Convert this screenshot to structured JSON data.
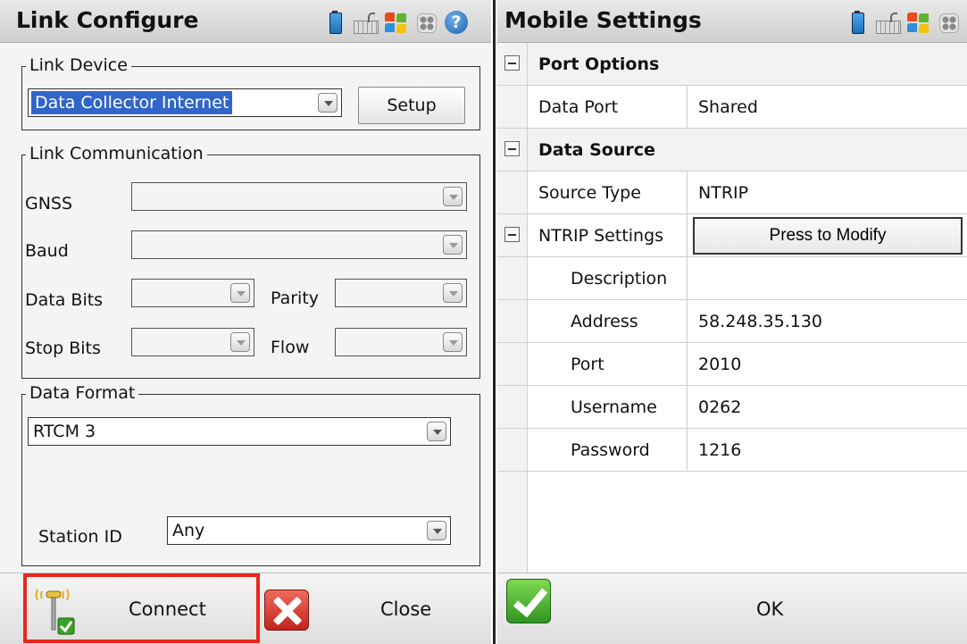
{
  "left": {
    "title": "Link Configure",
    "link_device": {
      "legend": "Link Device",
      "selected": "Data Collector Internet",
      "setup_label": "Setup"
    },
    "link_communication": {
      "legend": "Link Communication",
      "gnss_label": "GNSS",
      "baud_label": "Baud",
      "data_bits_label": "Data Bits",
      "parity_label": "Parity",
      "stop_bits_label": "Stop Bits",
      "flow_label": "Flow"
    },
    "data_format": {
      "legend": "Data Format",
      "selected": "RTCM 3",
      "station_id_label": "Station ID",
      "station_id_value": "Any"
    },
    "bottom": {
      "connect_label": "Connect",
      "close_label": "Close"
    }
  },
  "right": {
    "title": "Mobile Settings",
    "grid": {
      "port_options": "Port Options",
      "data_port_label": "Data Port",
      "data_port_value": "Shared",
      "data_source": "Data Source",
      "source_type_label": "Source Type",
      "source_type_value": "NTRIP",
      "ntrip_settings_label": "NTRIP Settings",
      "ntrip_settings_button": "Press to Modify",
      "description_label": "Description",
      "description_value": "",
      "address_label": "Address",
      "address_value": "58.248.35.130",
      "port_label": "Port",
      "port_value": "2010",
      "username_label": "Username",
      "username_value": "0262",
      "password_label": "Password",
      "password_value": "1216"
    },
    "bottom": {
      "ok_label": "OK"
    }
  },
  "icons": {
    "title_icons_left": [
      "battery-icon",
      "keyboard-icon",
      "windows-start-icon",
      "apps-icon",
      "help-icon"
    ],
    "title_icons_right": [
      "battery-icon",
      "keyboard-icon",
      "windows-start-icon",
      "apps-icon"
    ],
    "help_glyph": "?"
  },
  "colors": {
    "selection": "#3165c9",
    "highlight": "#e8281e",
    "ok_green": "#2f9421",
    "close_red": "#c2251a"
  }
}
